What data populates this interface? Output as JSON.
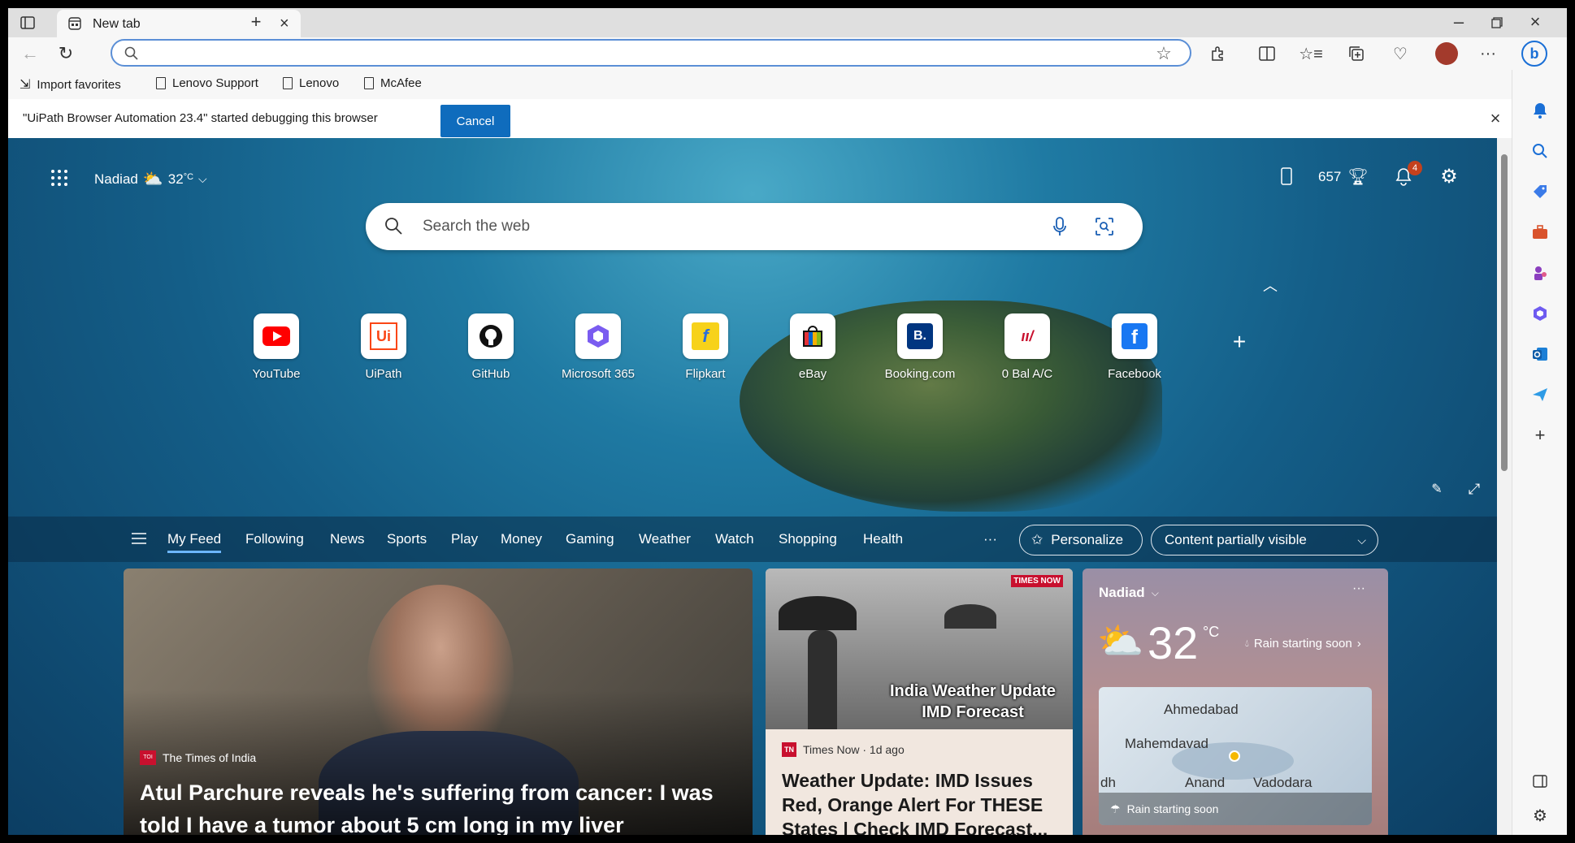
{
  "browser": {
    "tab_title": "New tab",
    "address_value": "",
    "favorites": [
      "Import favorites",
      "Lenovo Support",
      "Lenovo",
      "McAfee"
    ],
    "info_message": "\"UiPath Browser Automation 23.4\" started debugging this browser",
    "cancel_label": "Cancel"
  },
  "header": {
    "location": "Nadiad",
    "temperature": "32",
    "temp_unit": "°C",
    "points": "657",
    "notification_count": "4"
  },
  "search": {
    "placeholder": "Search the web"
  },
  "quick_links": [
    {
      "label": "YouTube"
    },
    {
      "label": "UiPath"
    },
    {
      "label": "GitHub"
    },
    {
      "label": "Microsoft 365"
    },
    {
      "label": "Flipkart"
    },
    {
      "label": "eBay"
    },
    {
      "label": "Booking.com"
    },
    {
      "label": "0 Bal A/C"
    },
    {
      "label": "Facebook"
    }
  ],
  "feed": {
    "tabs": [
      "My Feed",
      "Following",
      "News",
      "Sports",
      "Play",
      "Money",
      "Gaming",
      "Weather",
      "Watch",
      "Shopping",
      "Health"
    ],
    "more": "···",
    "personalize": "Personalize",
    "visibility": "Content partially visible"
  },
  "cards": {
    "main": {
      "source": "The Times of India",
      "source_badge": "TOI",
      "headline": "Atul Parchure reveals he's suffering from cancer: I was told I have a tumor about 5 cm long in my liver"
    },
    "second": {
      "overlay": "India Weather Update IMD Forecast",
      "corner_logo": "TIMES NOW",
      "source": "Times Now · 1d ago",
      "source_badge": "TN",
      "headline": "Weather Update: IMD Issues Red, Orange Alert For THESE States | Check IMD Forecast..."
    },
    "weather": {
      "location": "Nadiad",
      "temp": "32",
      "unit": "°C",
      "alert": "Rain starting soon",
      "map_labels": [
        "Ahmedabad",
        "Mahemdavad",
        "dh",
        "Anand",
        "Vadodara"
      ],
      "map_footer": "Rain starting soon"
    }
  }
}
